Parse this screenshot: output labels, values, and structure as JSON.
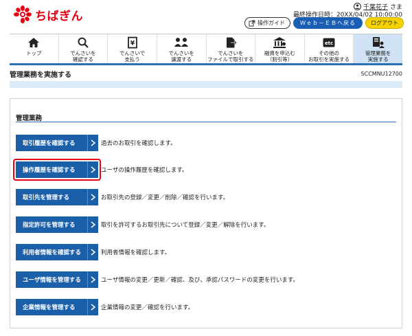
{
  "brand": {
    "name": "ちばぎん",
    "color": "#e60012"
  },
  "user": {
    "name": "千葉花子",
    "suffix": "さま",
    "last_login_label": "最終操作日時：20XX/04/02 10:00:00"
  },
  "header_buttons": {
    "guide": "操作ガイド",
    "web": "Ｗｅｂ－ＥＢへ戻る",
    "logout": "ログアウト"
  },
  "nav": [
    {
      "label1": "トップ",
      "label2": "",
      "icon": "home-icon"
    },
    {
      "label1": "でんさいを",
      "label2": "確認する",
      "icon": "search-icon"
    },
    {
      "label1": "でんさいで",
      "label2": "支払う",
      "icon": "payment-icon"
    },
    {
      "label1": "でんさいを",
      "label2": "譲渡する",
      "icon": "transfer-icon"
    },
    {
      "label1": "でんさいを",
      "label2": "ファイルで取引する",
      "icon": "file-icon"
    },
    {
      "label1": "融資を申込む",
      "label2": "（割引等）",
      "icon": "bank-icon"
    },
    {
      "label1": "その他の",
      "label2": "お取引を実施する",
      "icon": "etc-icon"
    },
    {
      "label1": "管理業務を",
      "label2": "実施する",
      "icon": "admin-icon"
    }
  ],
  "page": {
    "title": "管理業務を実施する",
    "screen_id": "SCCMNU12700"
  },
  "section": {
    "title": "管理業務"
  },
  "actions": [
    {
      "label": "取引履歴を確認する",
      "desc": "過去のお取引を確認します。"
    },
    {
      "label": "操作履歴を確認する",
      "desc": "ユーザの操作履歴を確認します。"
    },
    {
      "label": "取引先を管理する",
      "desc": "お取引先の登録／変更／削除／確認を行います。"
    },
    {
      "label": "指定許可を管理する",
      "desc": "取引を許可するお取引先について登録／変更／解除を行います。"
    },
    {
      "label": "利用者情報を確認する",
      "desc": "利用者情報を確認します。"
    },
    {
      "label": "ユーザ情報を管理する",
      "desc": "ユーザ情報の変更／更新／確認、及び、承認パスワードの変更を行います。"
    },
    {
      "label": "企業情報を管理する",
      "desc": "企業情報の変更／確認を行います。"
    }
  ],
  "colors": {
    "primary": "#1a5fa8",
    "highlight": "#e60012",
    "logout": "#f5d100"
  }
}
